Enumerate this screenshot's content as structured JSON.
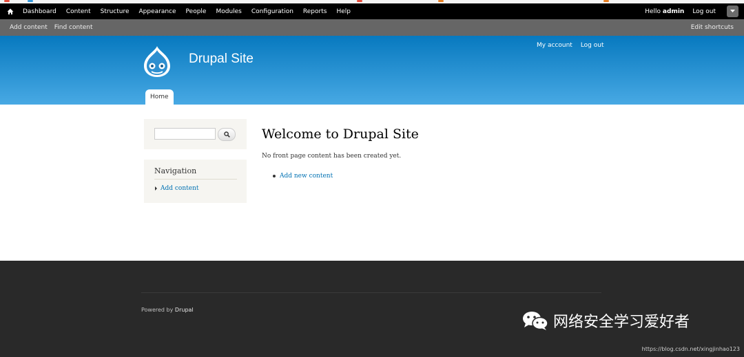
{
  "toolbar": {
    "menu": [
      "Dashboard",
      "Content",
      "Structure",
      "Appearance",
      "People",
      "Modules",
      "Configuration",
      "Reports",
      "Help"
    ],
    "hello_prefix": "Hello",
    "username": "admin",
    "logout": "Log out"
  },
  "shortcuts": {
    "items": [
      "Add content",
      "Find content"
    ],
    "edit": "Edit shortcuts"
  },
  "header": {
    "site_name": "Drupal Site",
    "secondary_menu": [
      "My account",
      "Log out"
    ],
    "tab_home": "Home"
  },
  "sidebar": {
    "search_value": "",
    "navigation_title": "Navigation",
    "navigation_items": [
      "Add content"
    ]
  },
  "main": {
    "title": "Welcome to Drupal Site",
    "text": "No front page content has been created yet.",
    "links": [
      "Add new content"
    ]
  },
  "footer": {
    "powered_prefix": "Powered by",
    "powered_link": "Drupal",
    "watermark": "网络安全学习爱好者",
    "source_url": "https://blog.csdn.net/xingjinhao123"
  },
  "colors": {
    "link": "#0071b3",
    "header_top": "#0779bf",
    "header_bottom": "#48a9e4",
    "footer": "#292929"
  }
}
